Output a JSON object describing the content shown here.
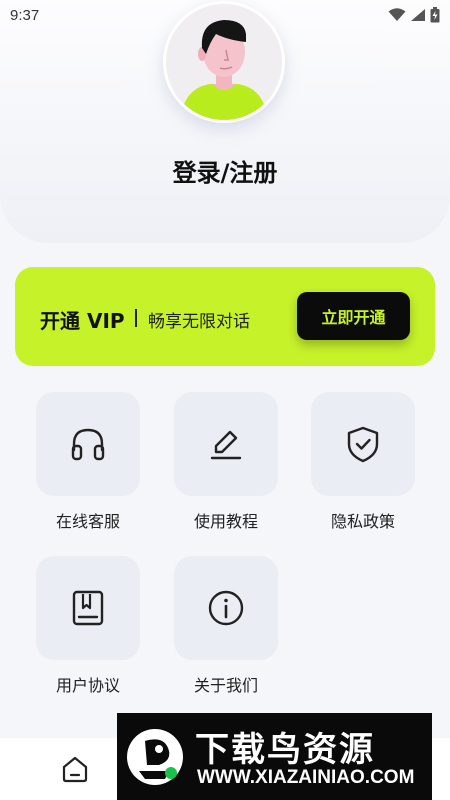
{
  "status_bar": {
    "time": "9:37"
  },
  "header": {
    "title": "登录/注册"
  },
  "vip_banner": {
    "title": "开通 VIP",
    "subtitle": "畅享无限对话",
    "button_label": "立即开通"
  },
  "menu": {
    "items": [
      {
        "label": "在线客服",
        "icon": "headphones-icon"
      },
      {
        "label": "使用教程",
        "icon": "edit-pen-icon"
      },
      {
        "label": "隐私政策",
        "icon": "shield-check-icon"
      },
      {
        "label": "用户协议",
        "icon": "book-icon"
      },
      {
        "label": "关于我们",
        "icon": "info-icon"
      }
    ]
  },
  "bottom_nav": {
    "home_icon": "home-icon"
  },
  "watermark": {
    "title": "下载鸟资源",
    "url": "WWW.XIAZAINIAO.COM"
  },
  "colors": {
    "accent": "#c6f22a",
    "dark": "#0b0b0b",
    "tile": "#eaedf3"
  }
}
